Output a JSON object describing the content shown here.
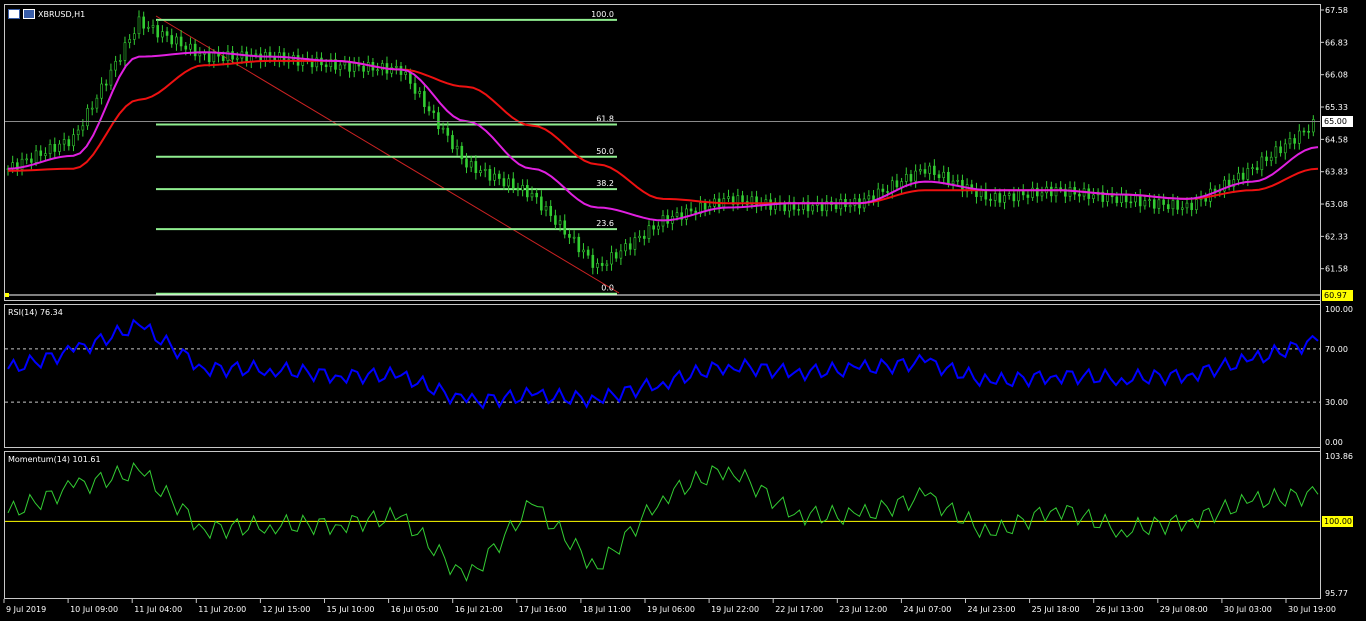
{
  "window": {
    "symbol_title": "XBRUSD,H1"
  },
  "price_axis": {
    "ticks": [
      "67.58",
      "66.83",
      "66.08",
      "65.33",
      "64.58",
      "63.83",
      "63.08",
      "62.33",
      "61.58"
    ],
    "current_price": "65.00",
    "low_marker": "60.97",
    "current_tag_color": "#ffffff",
    "low_tag_color": "#ffff00"
  },
  "fibonacci": {
    "levels": [
      "100.0",
      "61.8",
      "50.0",
      "38.2",
      "23.6",
      "0.0"
    ],
    "color": "#90ee90"
  },
  "rsi": {
    "title": "RSI(14) 76.34",
    "ticks": [
      "100.00",
      "70.00",
      "30.00",
      "0.00"
    ],
    "color": "#0000ff"
  },
  "momentum": {
    "title": "Momentum(14) 101.61",
    "ticks": [
      "103.86",
      "100.00",
      "95.77"
    ],
    "color": "#33cc33",
    "ref_color": "#ffff00"
  },
  "time_axis": {
    "labels": [
      "9 Jul 2019",
      "10 Jul 09:00",
      "11 Jul 04:00",
      "11 Jul 20:00",
      "12 Jul 15:00",
      "15 Jul 10:00",
      "16 Jul 05:00",
      "16 Jul 21:00",
      "17 Jul 16:00",
      "18 Jul 11:00",
      "19 Jul 06:00",
      "19 Jul 22:00",
      "22 Jul 17:00",
      "23 Jul 12:00",
      "24 Jul 07:00",
      "24 Jul 23:00",
      "25 Jul 18:00",
      "26 Jul 13:00",
      "29 Jul 08:00",
      "30 Jul 03:00",
      "30 Jul 19:00"
    ]
  },
  "chart_data": [
    {
      "type": "candlestick",
      "symbol": "XBRUSD",
      "timeframe": "H1",
      "ylim": [
        60.97,
        67.58
      ],
      "x": [
        "9 Jul 2019",
        "10 Jul 09:00",
        "11 Jul 04:00",
        "11 Jul 20:00",
        "12 Jul 15:00",
        "15 Jul 10:00",
        "16 Jul 05:00",
        "16 Jul 21:00",
        "17 Jul 16:00",
        "18 Jul 11:00",
        "19 Jul 06:00",
        "19 Jul 22:00",
        "22 Jul 17:00",
        "23 Jul 12:00",
        "24 Jul 07:00",
        "24 Jul 23:00",
        "25 Jul 18:00",
        "26 Jul 13:00",
        "29 Jul 08:00",
        "30 Jul 03:00",
        "30 Jul 19:00"
      ],
      "close": [
        63.9,
        64.6,
        67.3,
        66.5,
        66.5,
        66.3,
        66.2,
        64.0,
        63.3,
        61.6,
        62.7,
        63.2,
        63.0,
        63.1,
        63.9,
        63.2,
        63.4,
        63.2,
        63.0,
        63.9,
        65.0
      ],
      "ma_fast": {
        "color": "#e020e0",
        "values": [
          63.9,
          64.2,
          66.5,
          66.6,
          66.5,
          66.4,
          66.2,
          65.0,
          63.9,
          63.0,
          62.7,
          63.0,
          63.1,
          63.1,
          63.6,
          63.4,
          63.4,
          63.3,
          63.2,
          63.6,
          64.4
        ]
      },
      "ma_slow": {
        "color": "#ee1111",
        "values": [
          63.85,
          63.9,
          65.5,
          66.3,
          66.4,
          66.4,
          66.2,
          65.8,
          64.9,
          64.0,
          63.2,
          63.1,
          63.1,
          63.1,
          63.4,
          63.4,
          63.4,
          63.3,
          63.2,
          63.4,
          63.9
        ]
      }
    },
    {
      "type": "line",
      "title": "RSI(14) 76.34",
      "ylim": [
        0,
        100
      ],
      "levels": [
        70,
        30
      ],
      "x": [
        "9 Jul 2019",
        "10 Jul 09:00",
        "11 Jul 04:00",
        "11 Jul 20:00",
        "12 Jul 15:00",
        "15 Jul 10:00",
        "16 Jul 05:00",
        "16 Jul 21:00",
        "17 Jul 16:00",
        "18 Jul 11:00",
        "19 Jul 06:00",
        "19 Jul 22:00",
        "22 Jul 17:00",
        "23 Jul 12:00",
        "24 Jul 07:00",
        "24 Jul 23:00",
        "25 Jul 18:00",
        "26 Jul 13:00",
        "29 Jul 08:00",
        "30 Jul 03:00",
        "30 Jul 19:00"
      ],
      "values": [
        55,
        68,
        88,
        55,
        55,
        50,
        50,
        30,
        35,
        32,
        45,
        58,
        52,
        55,
        60,
        45,
        50,
        48,
        50,
        62,
        76
      ]
    },
    {
      "type": "line",
      "title": "Momentum(14) 101.61",
      "ylim": [
        95.77,
        103.86
      ],
      "levels": [
        100
      ],
      "x": [
        "9 Jul 2019",
        "10 Jul 09:00",
        "11 Jul 04:00",
        "11 Jul 20:00",
        "12 Jul 15:00",
        "15 Jul 10:00",
        "16 Jul 05:00",
        "16 Jul 21:00",
        "17 Jul 16:00",
        "18 Jul 11:00",
        "19 Jul 06:00",
        "19 Jul 22:00",
        "22 Jul 17:00",
        "23 Jul 12:00",
        "24 Jul 07:00",
        "24 Jul 23:00",
        "25 Jul 18:00",
        "26 Jul 13:00",
        "29 Jul 08:00",
        "30 Jul 03:00",
        "30 Jul 19:00"
      ],
      "values": [
        100.5,
        102.0,
        103.0,
        99.5,
        99.8,
        99.8,
        100.3,
        96.5,
        101.0,
        97.2,
        101.5,
        103.2,
        100.4,
        100.3,
        101.5,
        99.2,
        100.8,
        99.5,
        100.0,
        101.2,
        101.6
      ]
    }
  ]
}
